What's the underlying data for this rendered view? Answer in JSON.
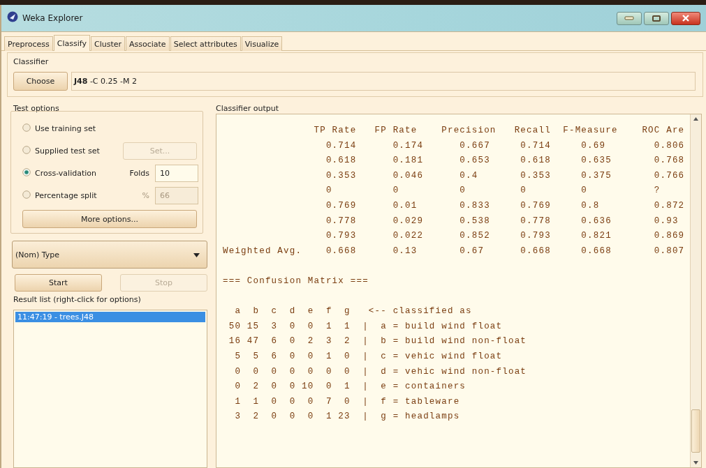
{
  "window": {
    "title": "Weka Explorer"
  },
  "tabs": [
    {
      "label": "Preprocess",
      "selected": false
    },
    {
      "label": "Classify",
      "selected": true
    },
    {
      "label": "Cluster",
      "selected": false
    },
    {
      "label": "Associate",
      "selected": false
    },
    {
      "label": "Select attributes",
      "selected": false
    },
    {
      "label": "Visualize",
      "selected": false
    }
  ],
  "classifier": {
    "title": "Classifier",
    "button": "Choose",
    "spec": "**J48** -C 0.25 -M 2"
  },
  "test_options": {
    "title": "Test options",
    "options": [
      {
        "kind": "plain",
        "label": "Use training set",
        "selected": false
      },
      {
        "kind": "button",
        "label": "Supplied test set",
        "selected": false,
        "button": "Set...",
        "disabled": true
      },
      {
        "kind": "field",
        "label": "Cross-validation",
        "selected": true,
        "field_label": "Folds",
        "value": "10",
        "disabled": false
      },
      {
        "kind": "field",
        "label": "Percentage split",
        "selected": false,
        "field_label": "%",
        "value": "66",
        "disabled": true
      }
    ],
    "more_button": "More options..."
  },
  "class_select": {
    "value": "(Nom) Type"
  },
  "start_button": {
    "label": "Start",
    "disabled": false
  },
  "stop_button": {
    "label": "Stop",
    "disabled": true
  },
  "result_list": {
    "title": "Result list (right-click for options)",
    "items": [
      {
        "label": "11:47:19 - trees.J48",
        "selected": true
      }
    ]
  },
  "output": {
    "title": "Classifier output",
    "accuracy": {
      "columns": [
        "TP Rate",
        "FP Rate",
        "Precision",
        "Recall",
        "F-Measure",
        "ROC Are"
      ],
      "rows": [
        {
          "values": [
            "0.714",
            "0.174",
            "0.667",
            "0.714",
            "0.69",
            "0.806"
          ]
        },
        {
          "values": [
            "0.618",
            "0.181",
            "0.653",
            "0.618",
            "0.635",
            "0.768"
          ]
        },
        {
          "values": [
            "0.353",
            "0.046",
            "0.4",
            "0.353",
            "0.375",
            "0.766"
          ]
        },
        {
          "values": [
            "0",
            "0",
            "0",
            "0",
            "0",
            "?"
          ]
        },
        {
          "values": [
            "0.769",
            "0.01",
            "0.833",
            "0.769",
            "0.8",
            "0.872"
          ]
        },
        {
          "values": [
            "0.778",
            "0.029",
            "0.538",
            "0.778",
            "0.636",
            "0.93"
          ]
        },
        {
          "values": [
            "0.793",
            "0.022",
            "0.852",
            "0.793",
            "0.821",
            "0.869"
          ]
        },
        {
          "label": "Weighted Avg.",
          "values": [
            "0.668",
            "0.13",
            "0.67",
            "0.668",
            "0.668",
            "0.807"
          ]
        }
      ]
    },
    "confusion": {
      "title": "=== Confusion Matrix ===",
      "letters": [
        "a",
        "b",
        "c",
        "d",
        "e",
        "f",
        "g"
      ],
      "header_note": "<-- classified as",
      "separator": "|",
      "rows": [
        {
          "counts": [
            "50",
            "15",
            "3",
            "0",
            "0",
            "1",
            "1"
          ],
          "label": "a = build wind float"
        },
        {
          "counts": [
            "16",
            "47",
            "6",
            "0",
            "2",
            "3",
            "2"
          ],
          "label": "b = build wind non-float"
        },
        {
          "counts": [
            "5",
            "5",
            "6",
            "0",
            "0",
            "1",
            "0"
          ],
          "label": "c = vehic wind float"
        },
        {
          "counts": [
            "0",
            "0",
            "0",
            "0",
            "0",
            "0",
            "0"
          ],
          "label": "d = vehic wind non-float"
        },
        {
          "counts": [
            "0",
            "2",
            "0",
            "0",
            "10",
            "0",
            "1"
          ],
          "label": "e = containers"
        },
        {
          "counts": [
            "1",
            "1",
            "0",
            "0",
            "0",
            "7",
            "0"
          ],
          "label": "f = tableware"
        },
        {
          "counts": [
            "3",
            "2",
            "0",
            "0",
            "0",
            "1",
            "23"
          ],
          "label": "g = headlamps"
        }
      ]
    }
  }
}
